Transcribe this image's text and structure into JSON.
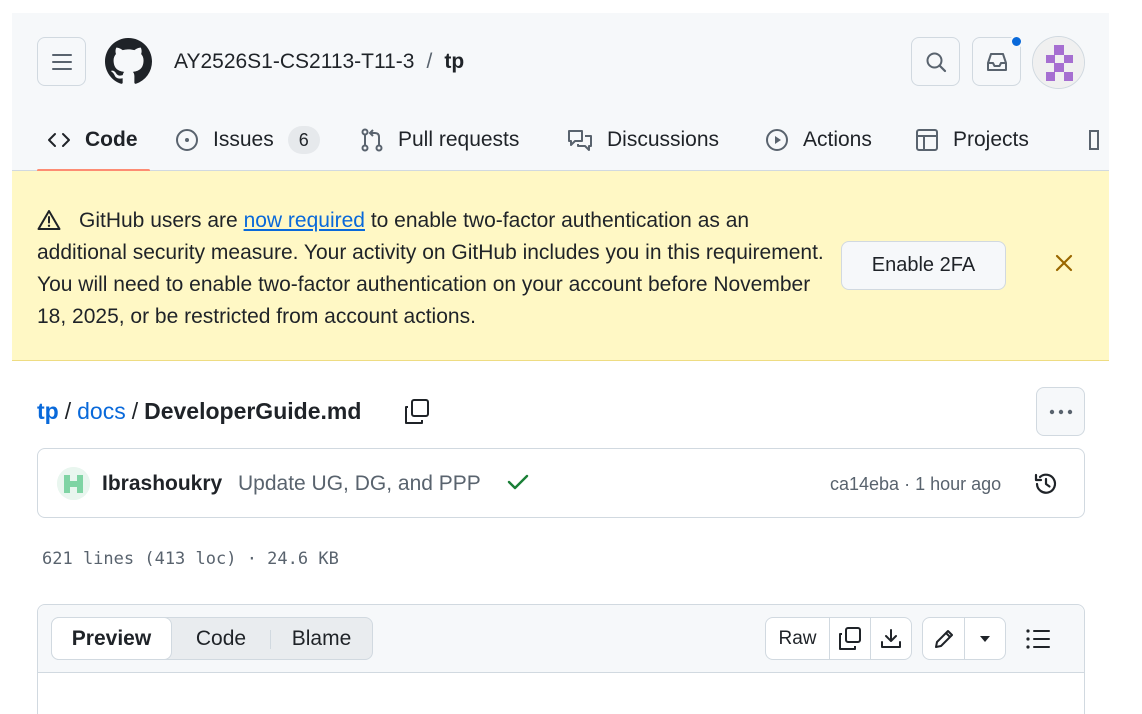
{
  "header": {
    "owner": "AY2526S1-CS2113-T11-3",
    "separator": "/",
    "repo": "tp"
  },
  "tabs": [
    {
      "label": "Code",
      "icon": "code-icon",
      "active": true
    },
    {
      "label": "Issues",
      "icon": "issue-opened-icon",
      "count": "6"
    },
    {
      "label": "Pull requests",
      "icon": "git-pull-request-icon"
    },
    {
      "label": "Discussions",
      "icon": "comment-discussion-icon"
    },
    {
      "label": "Actions",
      "icon": "play-icon"
    },
    {
      "label": "Projects",
      "icon": "table-icon"
    }
  ],
  "banner": {
    "text_before": "GitHub users are ",
    "link": "now required",
    "text_after": " to enable two-factor authentication as an additional security measure. Your activity on GitHub includes you in this requirement. You will need to enable two-factor authentication on your account before November 18, 2025, or be restricted from account actions.",
    "button": "Enable 2FA"
  },
  "breadcrumb": {
    "repo": "tp",
    "folder": "docs",
    "file": "DeveloperGuide.md",
    "sep": "/"
  },
  "commit": {
    "author": "Ibrashoukry",
    "message": "Update UG, DG, and PPP",
    "sha": "ca14eba",
    "dot": "·",
    "time": "1 hour ago"
  },
  "file_stats": "621 lines (413 loc) · 24.6 KB",
  "viewer": {
    "modes": [
      "Preview",
      "Code",
      "Blame"
    ],
    "active_mode": "Preview",
    "raw": "Raw"
  },
  "colors": {
    "accent": "#0969da",
    "tab_underline": "#fd8c73",
    "banner_bg": "#fff8c5",
    "success": "#1a7f37"
  }
}
